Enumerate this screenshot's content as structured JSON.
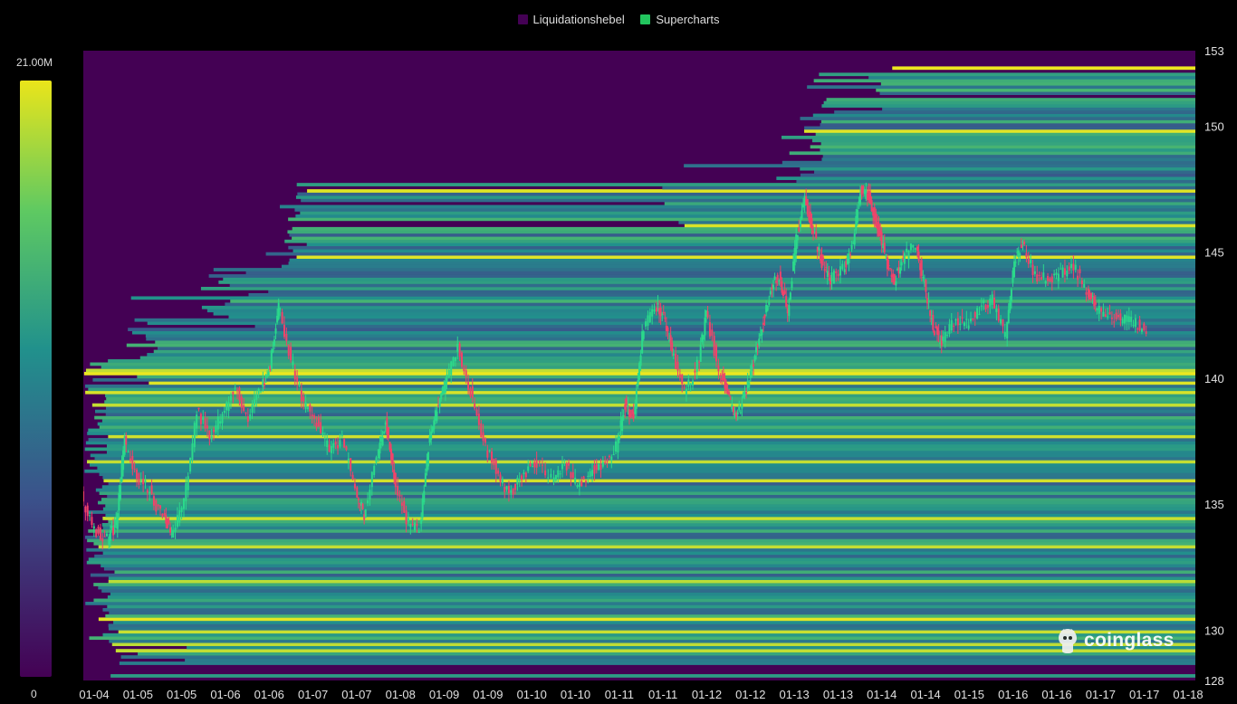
{
  "legend": [
    {
      "label": "Liquidationshebel",
      "color": "#440154"
    },
    {
      "label": "Supercharts",
      "color": "#22c55e"
    }
  ],
  "colorbar": {
    "max_label": "21.00M",
    "min_label": "0"
  },
  "watermark": "coinglass",
  "chart_data": {
    "type": "heatmap",
    "title": "",
    "xlabel": "",
    "ylabel": "",
    "legend_placement": "top-center",
    "ylim": [
      128,
      153
    ],
    "y_ticks": [
      128,
      130,
      135,
      140,
      145,
      150,
      153
    ],
    "x_tick_labels": [
      "01-04",
      "01-05",
      "01-05",
      "01-06",
      "01-06",
      "01-07",
      "01-07",
      "01-08",
      "01-09",
      "01-09",
      "01-10",
      "01-10",
      "01-11",
      "01-11",
      "01-12",
      "01-12",
      "01-13",
      "01-13",
      "01-14",
      "01-14",
      "01-15",
      "01-16",
      "01-16",
      "01-17",
      "01-17",
      "01-18"
    ],
    "colorscale": {
      "min": 0,
      "max": 21000000,
      "colors": [
        "#440154",
        "#3b528b",
        "#21918c",
        "#5ec962",
        "#fde725"
      ]
    },
    "price_series": {
      "name": "Supercharts",
      "x_range": [
        0,
        26
      ],
      "points": [
        [
          0,
          135.3
        ],
        [
          0.3,
          134.0
        ],
        [
          0.6,
          133.6
        ],
        [
          0.8,
          134.2
        ],
        [
          1.0,
          137.5
        ],
        [
          1.3,
          136.1
        ],
        [
          1.6,
          135.5
        ],
        [
          1.9,
          134.4
        ],
        [
          2.1,
          133.9
        ],
        [
          2.4,
          135.1
        ],
        [
          2.7,
          138.7
        ],
        [
          3.0,
          137.8
        ],
        [
          3.3,
          138.5
        ],
        [
          3.6,
          139.7
        ],
        [
          3.9,
          138.3
        ],
        [
          4.2,
          139.6
        ],
        [
          4.4,
          140.5
        ],
        [
          4.6,
          143.0
        ],
        [
          4.9,
          140.7
        ],
        [
          5.2,
          139.0
        ],
        [
          5.5,
          138.2
        ],
        [
          5.8,
          137.1
        ],
        [
          6.1,
          137.6
        ],
        [
          6.4,
          135.6
        ],
        [
          6.6,
          134.6
        ],
        [
          6.9,
          136.8
        ],
        [
          7.1,
          138.2
        ],
        [
          7.3,
          136.1
        ],
        [
          7.6,
          134.4
        ],
        [
          7.9,
          134.0
        ],
        [
          8.1,
          137.2
        ],
        [
          8.3,
          138.8
        ],
        [
          8.5,
          139.8
        ],
        [
          8.8,
          141.2
        ],
        [
          9.1,
          139.5
        ],
        [
          9.4,
          137.4
        ],
        [
          9.7,
          136.4
        ],
        [
          10.0,
          135.4
        ],
        [
          10.3,
          136.0
        ],
        [
          10.6,
          136.7
        ],
        [
          11.0,
          136.1
        ],
        [
          11.3,
          136.6
        ],
        [
          11.6,
          135.7
        ],
        [
          11.9,
          136.3
        ],
        [
          12.2,
          136.5
        ],
        [
          12.5,
          137.3
        ],
        [
          12.7,
          139.0
        ],
        [
          12.9,
          138.4
        ],
        [
          13.1,
          141.7
        ],
        [
          13.4,
          142.9
        ],
        [
          13.6,
          142.4
        ],
        [
          13.8,
          141.1
        ],
        [
          14.1,
          139.4
        ],
        [
          14.4,
          140.5
        ],
        [
          14.6,
          142.6
        ],
        [
          14.9,
          140.3
        ],
        [
          15.1,
          139.3
        ],
        [
          15.3,
          138.4
        ],
        [
          15.5,
          139.4
        ],
        [
          15.7,
          140.7
        ],
        [
          15.9,
          142.1
        ],
        [
          16.1,
          143.5
        ],
        [
          16.3,
          144.1
        ],
        [
          16.5,
          142.6
        ],
        [
          16.7,
          145.5
        ],
        [
          16.9,
          147.1
        ],
        [
          17.1,
          145.8
        ],
        [
          17.3,
          144.6
        ],
        [
          17.5,
          143.9
        ],
        [
          17.8,
          144.3
        ],
        [
          18.0,
          145.1
        ],
        [
          18.2,
          147.5
        ],
        [
          18.4,
          147.2
        ],
        [
          18.6,
          146.0
        ],
        [
          18.8,
          144.7
        ],
        [
          19.0,
          143.9
        ],
        [
          19.2,
          144.7
        ],
        [
          19.5,
          145.3
        ],
        [
          19.7,
          143.7
        ],
        [
          19.9,
          142.0
        ],
        [
          20.1,
          141.4
        ],
        [
          20.4,
          142.3
        ],
        [
          20.7,
          142.2
        ],
        [
          21.0,
          142.8
        ],
        [
          21.3,
          143.1
        ],
        [
          21.6,
          141.6
        ],
        [
          21.8,
          144.7
        ],
        [
          22.0,
          145.4
        ],
        [
          22.3,
          144.1
        ],
        [
          22.6,
          143.9
        ],
        [
          22.9,
          144.2
        ],
        [
          23.2,
          144.4
        ],
        [
          23.5,
          143.5
        ],
        [
          23.7,
          142.8
        ],
        [
          24.0,
          142.5
        ],
        [
          24.3,
          142.3
        ],
        [
          24.6,
          142.2
        ],
        [
          24.9,
          141.9
        ]
      ]
    }
  }
}
